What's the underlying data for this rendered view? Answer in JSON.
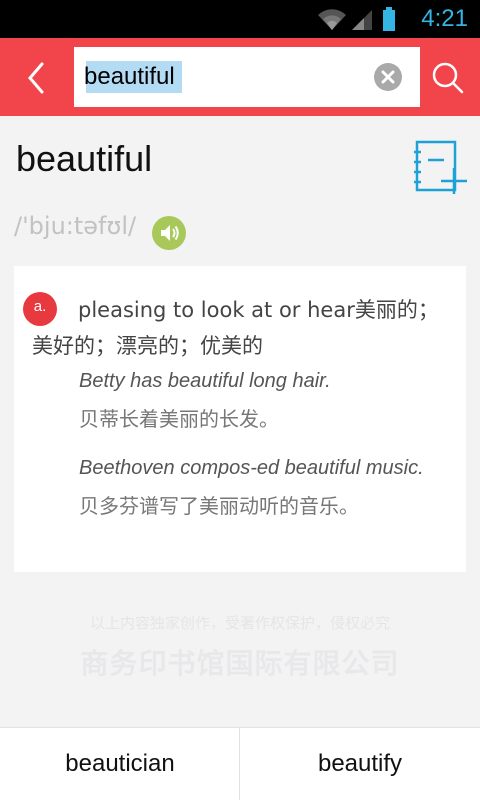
{
  "status_bar": {
    "time": "4:21",
    "icons": [
      "wifi-icon",
      "signal-icon",
      "battery-icon"
    ]
  },
  "toolbar": {
    "search_value": "beautiful",
    "back_icon": "chevron-left-icon",
    "clear_icon": "clear-icon",
    "search_icon": "search-icon",
    "accent_color": "#f2454b"
  },
  "entry": {
    "headword": "beautiful",
    "phonetic": "/'bju:tәfʊl/",
    "add_icon": "add-to-wordbook-icon",
    "speaker_icon": "speaker-icon",
    "senses": [
      {
        "pos": "a.",
        "definition": "pleasing to look at or hear美丽的；美好的；漂亮的；优美的",
        "examples": [
          {
            "en": "Betty has beautiful long hair.",
            "zh": "贝蒂长着美丽的长发。"
          },
          {
            "en": "Beethoven compos-ed beautiful music.",
            "zh": "贝多芬谱写了美丽动听的音乐。"
          }
        ]
      }
    ]
  },
  "footer": {
    "copyright": "以上内容独家创作，受著作权保护，侵权必究",
    "publisher": "商务印书馆国际有限公司"
  },
  "bottom_nav": {
    "prev_word": "beautician",
    "next_word": "beautify"
  }
}
